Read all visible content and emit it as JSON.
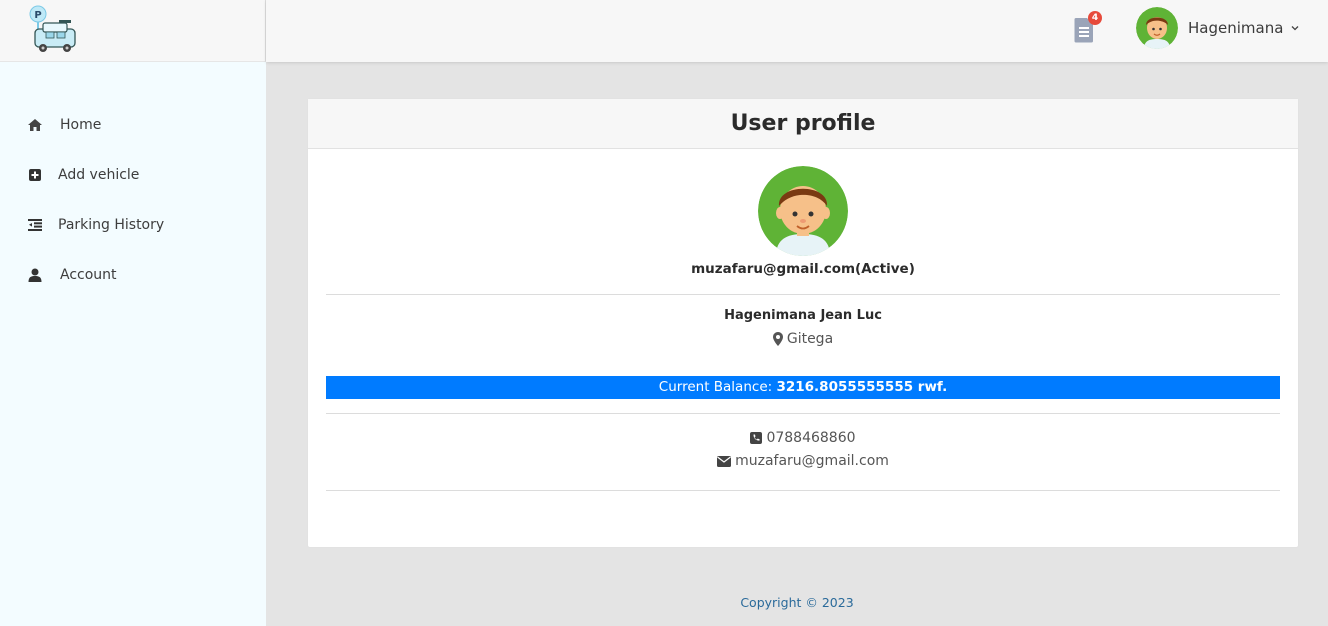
{
  "sidebar": {
    "items": [
      {
        "label": "Home",
        "icon": "home-icon"
      },
      {
        "label": "Add vehicle",
        "icon": "plus-square-icon"
      },
      {
        "label": "Parking History",
        "icon": "list-indent-icon"
      },
      {
        "label": "Account",
        "icon": "user-icon"
      }
    ]
  },
  "topbar": {
    "notification_count": "4",
    "notification_icon": "document-icon",
    "user_name": "Hagenimana"
  },
  "profile": {
    "title": "User profile",
    "email_status": "muzafaru@gmail.com(Active)",
    "full_name": "Hagenimana Jean Luc",
    "location": "Gitega",
    "balance_label": "Current Balance:",
    "balance_value": "3216.8055555555 rwf.",
    "phone": "0788468860",
    "email": "muzafaru@gmail.com"
  },
  "footer": {
    "copyright": "Copyright © 2023"
  },
  "colors": {
    "accent": "#007bff",
    "sidebar_bg": "#f3fcff",
    "badge": "#e74a3b",
    "page_bg": "#e4e4e4"
  }
}
